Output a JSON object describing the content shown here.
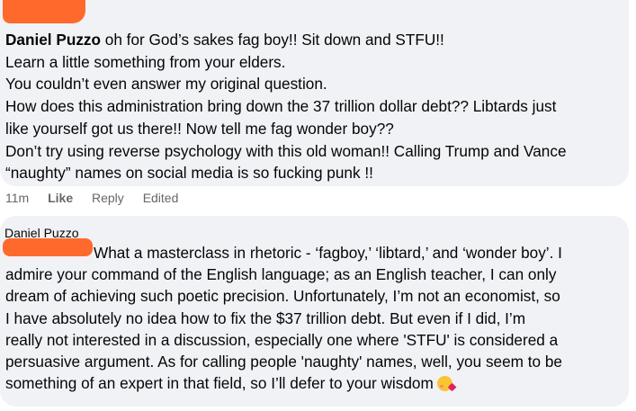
{
  "comment1": {
    "author": "Daniel Puzzo",
    "lines": [
      " oh for God’s sakes fag boy!! Sit down and STFU!!",
      "Learn a little something from your elders.",
      "You couldn’t even answer my original question.",
      "How does this administration bring down the 37 trillion dollar debt?? Libtards just",
      "like yourself got us there!! Now tell me fag wonder boy??",
      "Don’t try using reverse psychology with this old woman!! Calling Trump and Vance",
      "“naughty” names on social media is so fucking punk !!"
    ],
    "time": "11m",
    "like_label": "Like",
    "reply_label": "Reply",
    "edited_label": "Edited"
  },
  "comment2": {
    "tagged_name": "Daniel Puzzo",
    "lines": [
      "What a masterclass in rhetoric - ‘fagboy,’ ‘libtard,’ and ‘wonder boy’. I",
      "admire your command of the English language; as an English teacher, I can only",
      "dream of achieving such poetic precision. Unfortunately, I’m not an economist, so",
      "I have absolutely no idea how to fix the $37 trillion debt. But even if I did, I’m",
      "really not interested in a discussion, especially one where 'STFU' is considered a",
      "persuasive argument. As for calling people 'naughty' names, well, you seem to be",
      "something of an expert in that field, so I’ll defer to your wisdom"
    ],
    "emoji": "face-blowing-kiss-icon"
  }
}
